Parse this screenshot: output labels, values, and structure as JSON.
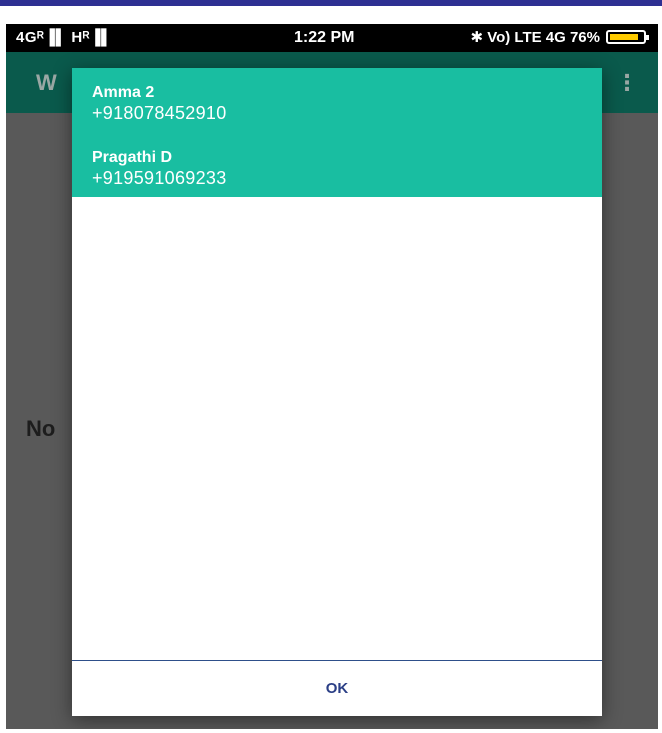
{
  "status_bar": {
    "left": "4Gᴿ▐▌ Hᴿ▐▌",
    "time": "1:22 PM",
    "right": "✱ Vo) LTE 4G 76%",
    "battery_level": 0.9,
    "battery_color": "#ffcc00"
  },
  "app_bar": {
    "title": "W",
    "menu_icon": "⋮"
  },
  "background": {
    "text": "No"
  },
  "dialog": {
    "contacts": [
      {
        "name": "Amma 2",
        "number": "+918078452910"
      },
      {
        "name": "Pragathi D",
        "number": "+919591069233"
      }
    ],
    "ok_label": "OK"
  },
  "colors": {
    "accent": "#19bea1",
    "app_bar": "#0a5a4c",
    "ok_text": "#2b3f86"
  }
}
